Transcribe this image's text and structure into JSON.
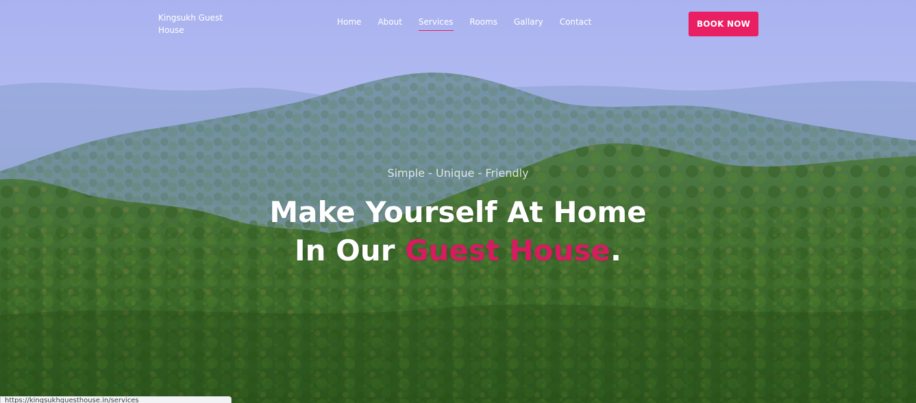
{
  "brand": {
    "name": "Kingsukh Guest House"
  },
  "nav": {
    "items": [
      {
        "label": "Home",
        "active": false
      },
      {
        "label": "About",
        "active": false
      },
      {
        "label": "Services",
        "active": true
      },
      {
        "label": "Rooms",
        "active": false
      },
      {
        "label": "Gallary",
        "active": false
      },
      {
        "label": "Contact",
        "active": false
      }
    ],
    "cta_label": "BOOK NOW"
  },
  "hero": {
    "tagline": "Simple - Unique - Friendly",
    "headline_line1": "Make Yourself At Home",
    "headline_prefix": "In Our ",
    "headline_accent": "Guest House",
    "headline_suffix": "."
  },
  "status_bar": {
    "url": "https://kingsukhguesthouse.in/services"
  },
  "colors": {
    "accent": "#e91e63",
    "headline_accent": "#d81b60",
    "sky": "#a9b4ee",
    "forest": "#3f6b2a"
  }
}
